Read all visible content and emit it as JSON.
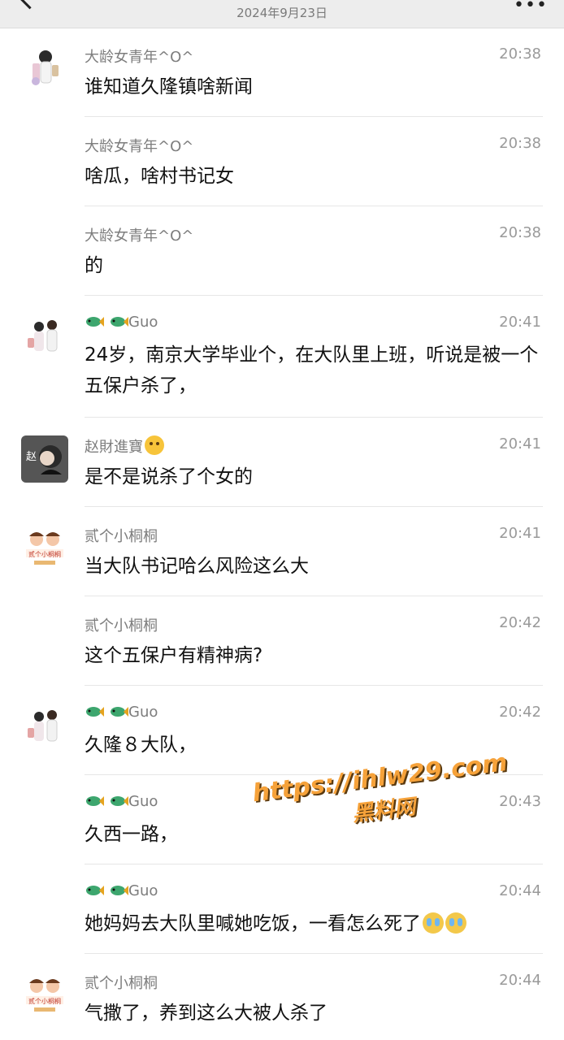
{
  "header": {
    "title": "",
    "subtitle": "2024年9月23日"
  },
  "messages": [
    {
      "sender": "大龄女青年^O^",
      "time": "20:38",
      "text": "谁知道久隆镇啥新闻"
    },
    {
      "sender": "大龄女青年^O^",
      "time": "20:38",
      "text": "啥瓜，啥村书记女"
    },
    {
      "sender": "大龄女青年^O^",
      "time": "20:38",
      "text": "的"
    },
    {
      "sender": "Guo",
      "time": "20:41",
      "text": "24岁，南京大学毕业个，在大队里上班，听说是被一个五保户杀了，"
    },
    {
      "sender": "赵財進寶",
      "time": "20:41",
      "text": "是不是说杀了个女的"
    },
    {
      "sender": "贰个小桐桐",
      "time": "20:41",
      "text": "当大队书记哈么风险这么大"
    },
    {
      "sender": "贰个小桐桐",
      "time": "20:42",
      "text": "这个五保户有精神病?"
    },
    {
      "sender": "Guo",
      "time": "20:42",
      "text": "久隆８大队，"
    },
    {
      "sender": "Guo",
      "time": "20:43",
      "text": "久西一路，"
    },
    {
      "sender": "Guo",
      "time": "20:44",
      "text": "她妈妈去大队里喊她吃饭，一看怎么死了"
    },
    {
      "sender": "贰个小桐桐",
      "time": "20:44",
      "text": "气撒了，养到这么大被人杀了"
    }
  ],
  "avatars": {
    "zhao_char": "赵",
    "tong_caption": "贰个小桐桐"
  },
  "watermark": {
    "url": "https://ihlw29.com",
    "name": "黑料网"
  },
  "colors": {
    "header_bg": "#ededed",
    "watermark": "#f6a23a"
  }
}
